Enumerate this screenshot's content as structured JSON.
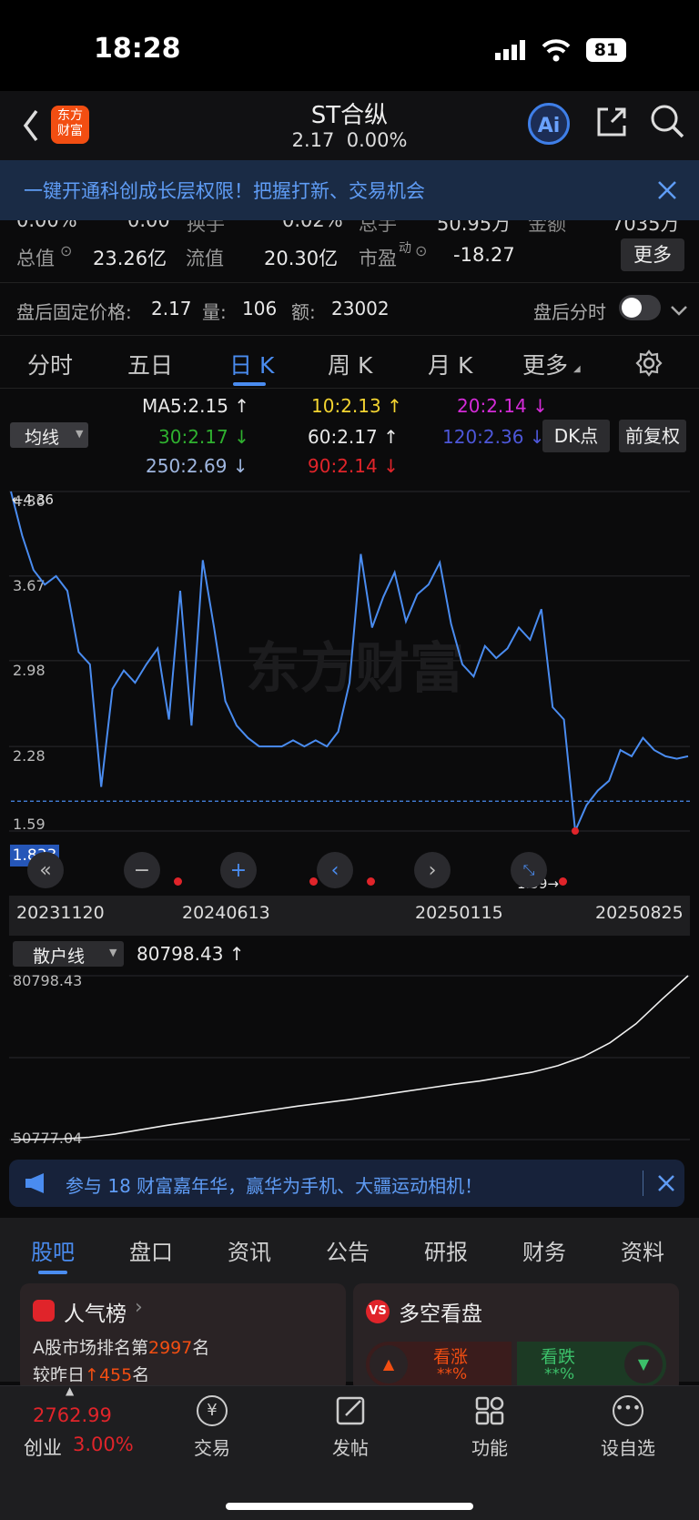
{
  "status_bar": {
    "time": "18:28",
    "battery": "81"
  },
  "header": {
    "logo_line1": "东方",
    "logo_line2": "财富",
    "title": "ST合纵",
    "price": "2.17",
    "change": "0.00%"
  },
  "banner": {
    "text": "一键开通科创成长层权限！把握打新、交易机会"
  },
  "quote": {
    "partial_row": [
      "0.00%",
      "0.00",
      "换手",
      "0.02%",
      "总手",
      "50.95万",
      "金额",
      "7035万"
    ],
    "total_value_label": "总值",
    "total_value": "23.26亿",
    "float_value_label": "流值",
    "float_value": "20.30亿",
    "pe_label": "市盈",
    "pe_sup": "动",
    "pe_value": "-18.27",
    "more_btn": "更多"
  },
  "after_hours": {
    "fixed_price_label": "盘后固定价格:",
    "fixed_price": "2.17",
    "volume_label": "量:",
    "volume": "106",
    "amount_label": "额:",
    "amount": "23002",
    "toggle_label": "盘后分时"
  },
  "chart_tabs": [
    "分时",
    "五日",
    "日 K",
    "周 K",
    "月 K",
    "更多"
  ],
  "ma_selector": "均线",
  "ma_values": [
    {
      "text": "MA5:2.15 ↑",
      "color": "#e8e8e8"
    },
    {
      "text": "10:2.13 ↑",
      "color": "#f3d431"
    },
    {
      "text": "20:2.14 ↓",
      "color": "#d42bd8"
    },
    {
      "text": "30:2.17 ↓",
      "color": "#2fb12f"
    },
    {
      "text": "60:2.17 ↑",
      "color": "#e8e8e8"
    },
    {
      "text": "120:2.36 ↓",
      "color": "#4d57d9"
    },
    {
      "text": "250:2.69 ↓",
      "color": "#9fb6df"
    },
    {
      "text": "90:2.14 ↓",
      "color": "#e0242a"
    }
  ],
  "dk_btn": "DK点",
  "fq_btn": "前复权",
  "chart_data": {
    "type": "line",
    "title": "",
    "y_ticks": [
      "4.36",
      "3.67",
      "2.98",
      "2.28",
      "1.59"
    ],
    "ylim": [
      1.59,
      4.36
    ],
    "max_marker": "4.36",
    "min_marker": "1.59",
    "current_marker": "1.833",
    "x_ticks": [
      "20231120",
      "20240613",
      "20250115",
      "20250825"
    ],
    "x": [
      0,
      1,
      2,
      3,
      4,
      5,
      6,
      7,
      8,
      9,
      10,
      11,
      12,
      13,
      14,
      15,
      16,
      17,
      18,
      19,
      20,
      21,
      22,
      23,
      24,
      25,
      26,
      27,
      28,
      29,
      30,
      31,
      32,
      33,
      34,
      35,
      36,
      37,
      38,
      39,
      40,
      41,
      42,
      43,
      44,
      45,
      46,
      47,
      48,
      49,
      50,
      51,
      52,
      53,
      54,
      55,
      56,
      57,
      58,
      59,
      60
    ],
    "series": [
      {
        "values": [
          4.36,
          4.0,
          3.72,
          3.6,
          3.67,
          3.55,
          3.05,
          2.95,
          1.95,
          2.75,
          2.9,
          2.8,
          2.95,
          3.08,
          2.5,
          3.55,
          2.45,
          3.8,
          3.25,
          2.65,
          2.45,
          2.35,
          2.28,
          2.28,
          2.28,
          2.33,
          2.28,
          2.33,
          2.28,
          2.4,
          2.8,
          3.85,
          3.25,
          3.5,
          3.7,
          3.3,
          3.52,
          3.6,
          3.78,
          3.28,
          2.95,
          2.85,
          3.1,
          3.0,
          3.08,
          3.25,
          3.15,
          3.4,
          2.6,
          2.5,
          1.59,
          1.8,
          1.92,
          2.0,
          2.25,
          2.2,
          2.35,
          2.25,
          2.2,
          2.18,
          2.2
        ]
      },
      {
        "name": "散户线",
        "values": [
          50777.04,
          50800,
          50900,
          51200,
          51800,
          52600,
          53400,
          54100,
          54800,
          55500,
          56200,
          56900,
          57500,
          58100,
          58800,
          59500,
          60200,
          60900,
          61500,
          62300,
          63100,
          64300,
          66000,
          68500,
          72000,
          76500,
          80798.43
        ]
      }
    ],
    "retail_label": "散户线",
    "retail_value": "80798.43 ↑",
    "retail_y_ticks": [
      "80798.43",
      "50777.04"
    ]
  },
  "promo": {
    "text": "参与 18 财富嘉年华，赢华为手机、大疆运动相机！"
  },
  "bottom_tabs": [
    "股吧",
    "盘口",
    "资讯",
    "公告",
    "研报",
    "财务",
    "资料"
  ],
  "popularity": {
    "title": "人气榜",
    "rank_prefix": "A股市场排名第",
    "rank": "2997",
    "rank_suffix": "名",
    "prev_prefix": "较昨日",
    "prev_change": "455",
    "prev_suffix": "名"
  },
  "bull_bear": {
    "title": "多空看盘",
    "bull": "看涨",
    "bear": "看跌",
    "bull_pct": "**%",
    "bear_pct": "**%"
  },
  "bottom_nav": {
    "index_value": "2762.99",
    "index_name": "创业",
    "index_change": "3.00%",
    "items": [
      "交易",
      "发帖",
      "功能",
      "设自选"
    ]
  },
  "colors": {
    "accent": "#4a8cf0",
    "up": "#e0242a",
    "down": "#2fb12f",
    "brand": "#f24e12"
  }
}
